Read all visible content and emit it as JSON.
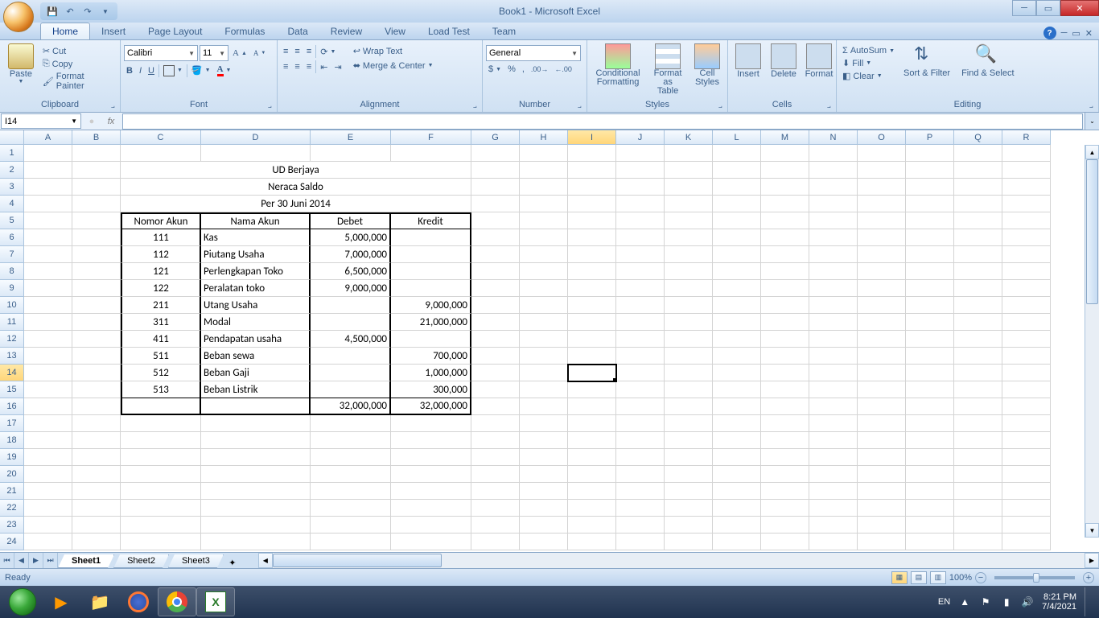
{
  "title": "Book1 - Microsoft Excel",
  "qat": {
    "save": "💾",
    "undo": "↶",
    "redo": "↷"
  },
  "tabs": [
    "Home",
    "Insert",
    "Page Layout",
    "Formulas",
    "Data",
    "Review",
    "View",
    "Load Test",
    "Team"
  ],
  "activeTab": "Home",
  "ribbon": {
    "clipboard": {
      "paste": "Paste",
      "cut": "Cut",
      "copy": "Copy",
      "fmt": "Format Painter",
      "label": "Clipboard"
    },
    "font": {
      "name": "Calibri",
      "size": "11",
      "bold": "B",
      "italic": "I",
      "underline": "U",
      "label": "Font"
    },
    "alignment": {
      "wrap": "Wrap Text",
      "merge": "Merge & Center",
      "label": "Alignment"
    },
    "number": {
      "fmt": "General",
      "label": "Number"
    },
    "styles": {
      "cond": "Conditional Formatting",
      "table": "Format as Table",
      "cell": "Cell Styles",
      "label": "Styles"
    },
    "cells": {
      "insert": "Insert",
      "delete": "Delete",
      "format": "Format",
      "label": "Cells"
    },
    "editing": {
      "sum": "AutoSum",
      "fill": "Fill",
      "clear": "Clear",
      "sort": "Sort & Filter",
      "find": "Find & Select",
      "label": "Editing"
    }
  },
  "namebox": "I14",
  "columns": [
    {
      "l": "A",
      "w": 60
    },
    {
      "l": "B",
      "w": 60
    },
    {
      "l": "C",
      "w": 100
    },
    {
      "l": "D",
      "w": 136
    },
    {
      "l": "E",
      "w": 100
    },
    {
      "l": "F",
      "w": 100
    },
    {
      "l": "G",
      "w": 60
    },
    {
      "l": "H",
      "w": 60
    },
    {
      "l": "I",
      "w": 60
    },
    {
      "l": "J",
      "w": 60
    },
    {
      "l": "K",
      "w": 60
    },
    {
      "l": "L",
      "w": 60
    },
    {
      "l": "M",
      "w": 60
    },
    {
      "l": "N",
      "w": 60
    },
    {
      "l": "O",
      "w": 60
    },
    {
      "l": "P",
      "w": 60
    },
    {
      "l": "Q",
      "w": 60
    },
    {
      "l": "R",
      "w": 60
    }
  ],
  "rowCount": 24,
  "selected": {
    "col": "I",
    "row": 14
  },
  "sheet": {
    "title1": "UD Berjaya",
    "title2": "Neraca Saldo",
    "title3": "Per 30 Juni 2014",
    "headers": {
      "c": "Nomor Akun",
      "d": "Nama Akun",
      "e": "Debet",
      "f": "Kredit"
    },
    "rows": [
      {
        "c": "111",
        "d": "Kas",
        "e": "5,000,000",
        "f": ""
      },
      {
        "c": "112",
        "d": "Piutang Usaha",
        "e": "7,000,000",
        "f": ""
      },
      {
        "c": "121",
        "d": "Perlengkapan Toko",
        "e": "6,500,000",
        "f": ""
      },
      {
        "c": "122",
        "d": "Peralatan toko",
        "e": "9,000,000",
        "f": ""
      },
      {
        "c": "211",
        "d": "Utang Usaha",
        "e": "",
        "f": "9,000,000"
      },
      {
        "c": "311",
        "d": "Modal",
        "e": "",
        "f": "21,000,000"
      },
      {
        "c": "411",
        "d": "Pendapatan usaha",
        "e": "4,500,000",
        "f": ""
      },
      {
        "c": "511",
        "d": "Beban sewa",
        "e": "",
        "f": "700,000"
      },
      {
        "c": "512",
        "d": "Beban Gaji",
        "e": "",
        "f": "1,000,000"
      },
      {
        "c": "513",
        "d": "Beban Listrik",
        "e": "",
        "f": "300,000"
      }
    ],
    "totals": {
      "e": "32,000,000",
      "f": "32,000,000"
    }
  },
  "sheets": [
    "Sheet1",
    "Sheet2",
    "Sheet3"
  ],
  "activeSheet": "Sheet1",
  "status": {
    "ready": "Ready",
    "zoom": "100%"
  },
  "taskbar": {
    "lang": "EN",
    "time": "8:21 PM",
    "date": "7/4/2021"
  }
}
